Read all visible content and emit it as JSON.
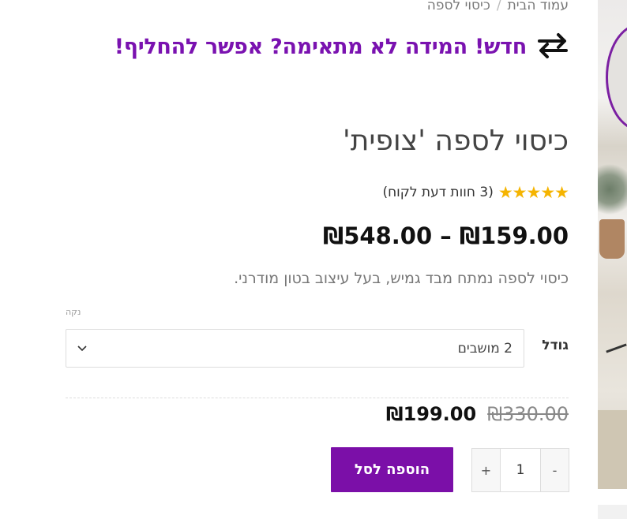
{
  "breadcrumb": {
    "home": "עמוד הבית",
    "separator": "/",
    "current": "כיסוי לספה"
  },
  "promo": {
    "text": "חדש! המידה לא מתאימה? אפשר להחליף!",
    "icon": "swap-arrows-icon"
  },
  "product": {
    "title": "כיסוי לספה 'צופית'",
    "stars": "★★★★★",
    "rating": 5,
    "reviews_text": "(3 חוות דעת לקוח)",
    "price_range": "₪159.00 – ₪548.00",
    "description": "כיסוי לספה נמתח מבד גמיש, בעל עיצוב בטון מודרני."
  },
  "variation": {
    "size_label": "גודל",
    "size_value": "2 מושבים",
    "clear_label": "נקה",
    "old_price": "₪330.00",
    "new_price": "₪199.00"
  },
  "cart": {
    "minus": "-",
    "quantity": "1",
    "plus": "+",
    "add_label": "הוספה לסל"
  },
  "colors": {
    "accent": "#7b0fa8",
    "star": "#f5b400"
  }
}
